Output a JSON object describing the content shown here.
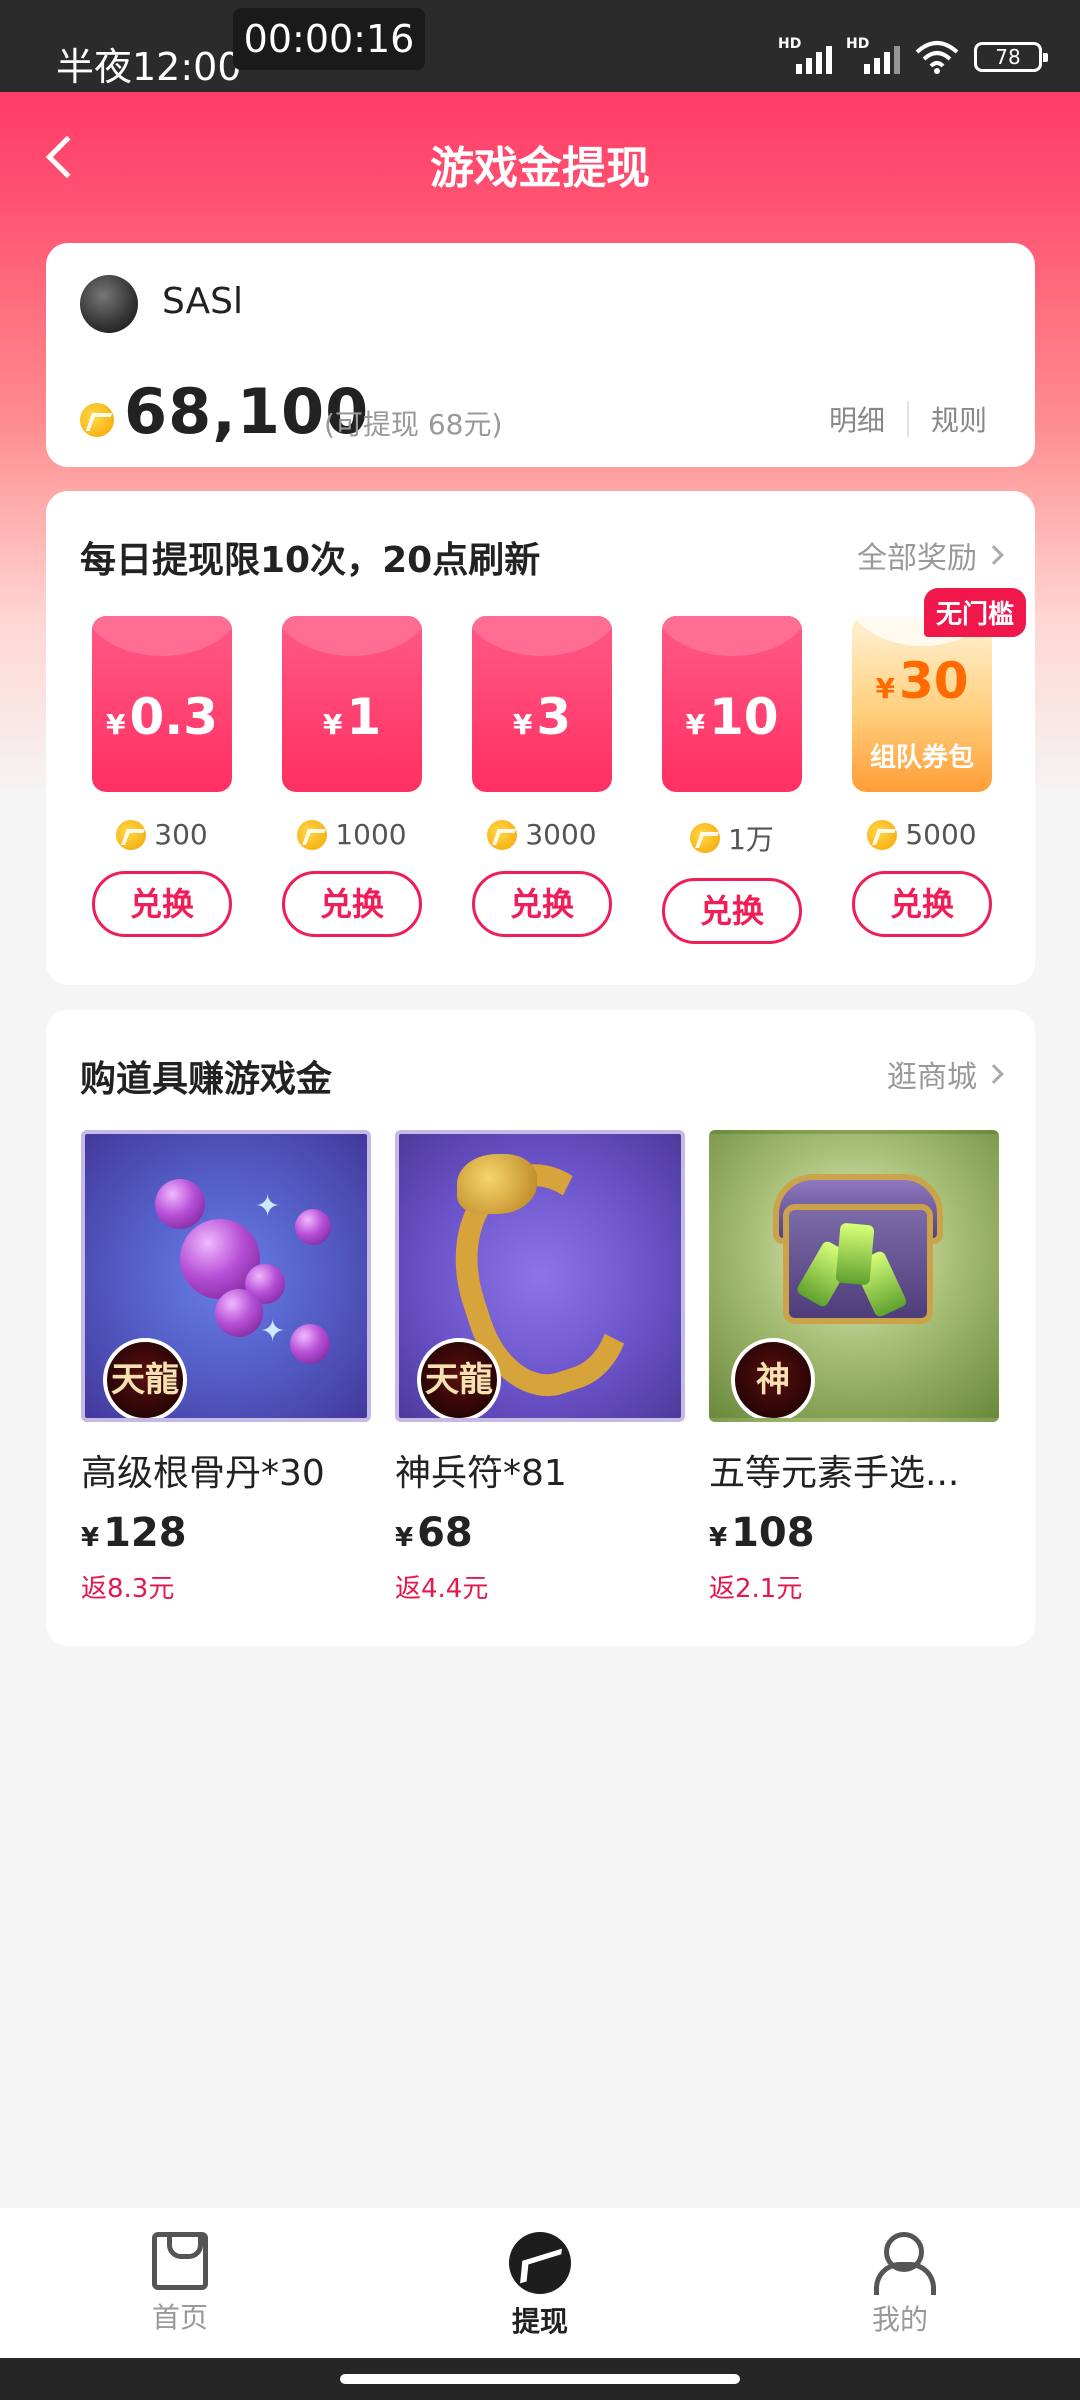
{
  "status_bar": {
    "time": "半夜12:00",
    "timer": "00:00:16",
    "battery": "78",
    "hd_label": "HD"
  },
  "header": {
    "title": "游戏金提现"
  },
  "account": {
    "username": "SASl",
    "balance": "68,100",
    "withdrawable": "(可提现 68元)",
    "detail_link": "明细",
    "rules_link": "规则"
  },
  "withdraw": {
    "title": "每日提现限10次，20点刷新",
    "all_rewards": "全部奖励",
    "currency": "¥",
    "packets": [
      {
        "amount": "0.3",
        "cost": "300",
        "button": "兑换"
      },
      {
        "amount": "1",
        "cost": "1000",
        "button": "兑换"
      },
      {
        "amount": "3",
        "cost": "3000",
        "button": "兑换"
      },
      {
        "amount": "10",
        "cost": "1万",
        "button": "兑换"
      },
      {
        "amount": "30",
        "cost": "5000",
        "button": "兑换",
        "badge": "无门槛",
        "subtitle": "组队券包"
      }
    ]
  },
  "shop": {
    "title": "购道具赚游戏金",
    "mall_link": "逛商城",
    "currency": "¥",
    "items": [
      {
        "name": "高级根骨丹*30",
        "price": "128",
        "rebate": "返8.3元",
        "logo": "天龍"
      },
      {
        "name": "神兵符*81",
        "price": "68",
        "rebate": "返4.4元",
        "logo": "天龍"
      },
      {
        "name": "五等元素手选...",
        "price": "108",
        "rebate": "返2.1元",
        "logo": "神"
      }
    ]
  },
  "bottom_nav": {
    "items": [
      {
        "label": "首页",
        "icon": "bag-icon"
      },
      {
        "label": "提现",
        "icon": "withdraw-icon",
        "active": true
      },
      {
        "label": "我的",
        "icon": "user-icon"
      }
    ]
  },
  "colors": {
    "accent": "#f01d57",
    "header_gradient_top": "#ff2a5f",
    "coin": "#f5a300"
  }
}
